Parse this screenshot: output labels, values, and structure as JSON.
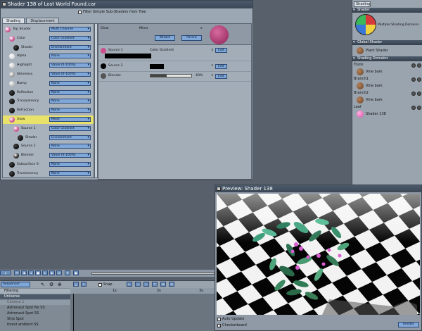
{
  "shader_window": {
    "title": "Shader 138 of Lost World Found.car",
    "filter_label": "Filter Simple Sub-Shaders from Tree",
    "tabs": [
      "Shading",
      "Displacement"
    ],
    "tree": [
      {
        "label": "Top Shader",
        "value": "Multi Channel",
        "color": "#c9508d",
        "indent": 0
      },
      {
        "label": "Color",
        "value": "Color Gradient",
        "color": "#c9508d",
        "indent": 1
      },
      {
        "label": "Shader",
        "value": "Environment",
        "color": "#111111",
        "indent": 2
      },
      {
        "label": "Alpha",
        "value": "None",
        "color": "#dddddd",
        "indent": 1
      },
      {
        "label": "Highlight",
        "value": "Value (0-100%)",
        "color": "#cccccc",
        "indent": 1
      },
      {
        "label": "Shininess",
        "value": "Value (0-100%)",
        "color": "#999999",
        "indent": 1
      },
      {
        "label": "Bump",
        "value": "None",
        "color": "#bbbbbb",
        "indent": 1
      },
      {
        "label": "Reflection",
        "value": "None",
        "color": "#111111",
        "indent": 1
      },
      {
        "label": "Transparency",
        "value": "None",
        "color": "#111111",
        "indent": 1
      },
      {
        "label": "Refraction",
        "value": "None",
        "color": "#111111",
        "indent": 1
      },
      {
        "label": "Glow",
        "value": "Mixer",
        "color": "#c9508d",
        "indent": 1,
        "selected": true
      },
      {
        "label": "Source 1",
        "value": "Color Gradient",
        "color": "#c9508d",
        "indent": 2
      },
      {
        "label": "Shader",
        "value": "Environment",
        "color": "#111111",
        "indent": 3
      },
      {
        "label": "Source 2",
        "value": "None",
        "color": "#111111",
        "indent": 2
      },
      {
        "label": "Blender",
        "value": "Value (0-100%)",
        "color": "#222222",
        "indent": 2
      },
      {
        "label": "Subsurface S-",
        "value": "None",
        "color": "#111111",
        "indent": 1
      },
      {
        "label": "Translucency",
        "value": "None",
        "color": "#111111",
        "indent": 1
      }
    ],
    "detail": {
      "name": "Glow",
      "type": "Mixer",
      "close": "x",
      "wizard_label": "Wizard",
      "parent_label": "Parent",
      "rows": [
        {
          "label": "Source 1",
          "value": "Color Gradient",
          "edit": "Edit"
        },
        {
          "label": "Source 2",
          "value": "",
          "edit": "Edit"
        },
        {
          "label": "Blender",
          "value": "40%",
          "edit": "Edit"
        }
      ],
      "blender_level": 0.4
    }
  },
  "right_panel": {
    "tab": "Shading",
    "shader_head": "Shader",
    "shader_name": "Multiple Shading Domains",
    "global_head": "Global Shader",
    "global_name": "Plant Shader",
    "domains_head": "Shading Domains",
    "domains": [
      {
        "group": "Trunk",
        "name": "Vine bark"
      },
      {
        "group": "Branch1",
        "name": "Vine bark"
      },
      {
        "group": "Branch2",
        "name": "Vine bark"
      },
      {
        "group": "Leaf",
        "name": "Shader 138"
      }
    ]
  },
  "preview": {
    "title": "Preview: Shader 138",
    "auto_update": "Auto Update",
    "checkerboard": "Checkerboard",
    "render": "Render"
  },
  "timeline": {
    "sequencer_label": "Sequencer",
    "snap_label": "Snap",
    "filtering_label": "Filtering",
    "ticks": [
      "1s",
      "2s",
      "3s"
    ],
    "items": [
      "Universe",
      "Camera 1",
      "Astronaut Spot No SS",
      "Astronaut Spot SS",
      "Ship Spot",
      "forest ambient SS"
    ]
  },
  "colors": {
    "accent": "#7fa7d8",
    "selected": "#e9e26a",
    "glow": "#c9508d"
  }
}
